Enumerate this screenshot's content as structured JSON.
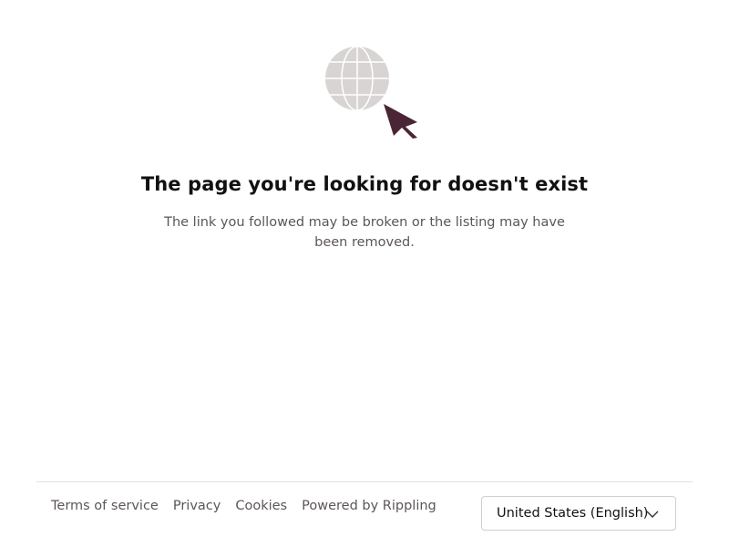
{
  "error": {
    "title": "The page you're looking for doesn't exist",
    "message": "The link you followed may be broken or the listing may have been removed."
  },
  "illustration": {
    "globe_icon": "globe-icon",
    "cursor_icon": "cursor-arrow-icon",
    "globe_color": "#d9d4d4",
    "cursor_color": "#4a2535"
  },
  "footer": {
    "links": {
      "terms": "Terms of service",
      "privacy": "Privacy",
      "cookies": "Cookies",
      "powered_by": "Powered by Rippling"
    },
    "locale": {
      "selected": "United States (English)",
      "icon": "chevron-down-icon"
    }
  }
}
